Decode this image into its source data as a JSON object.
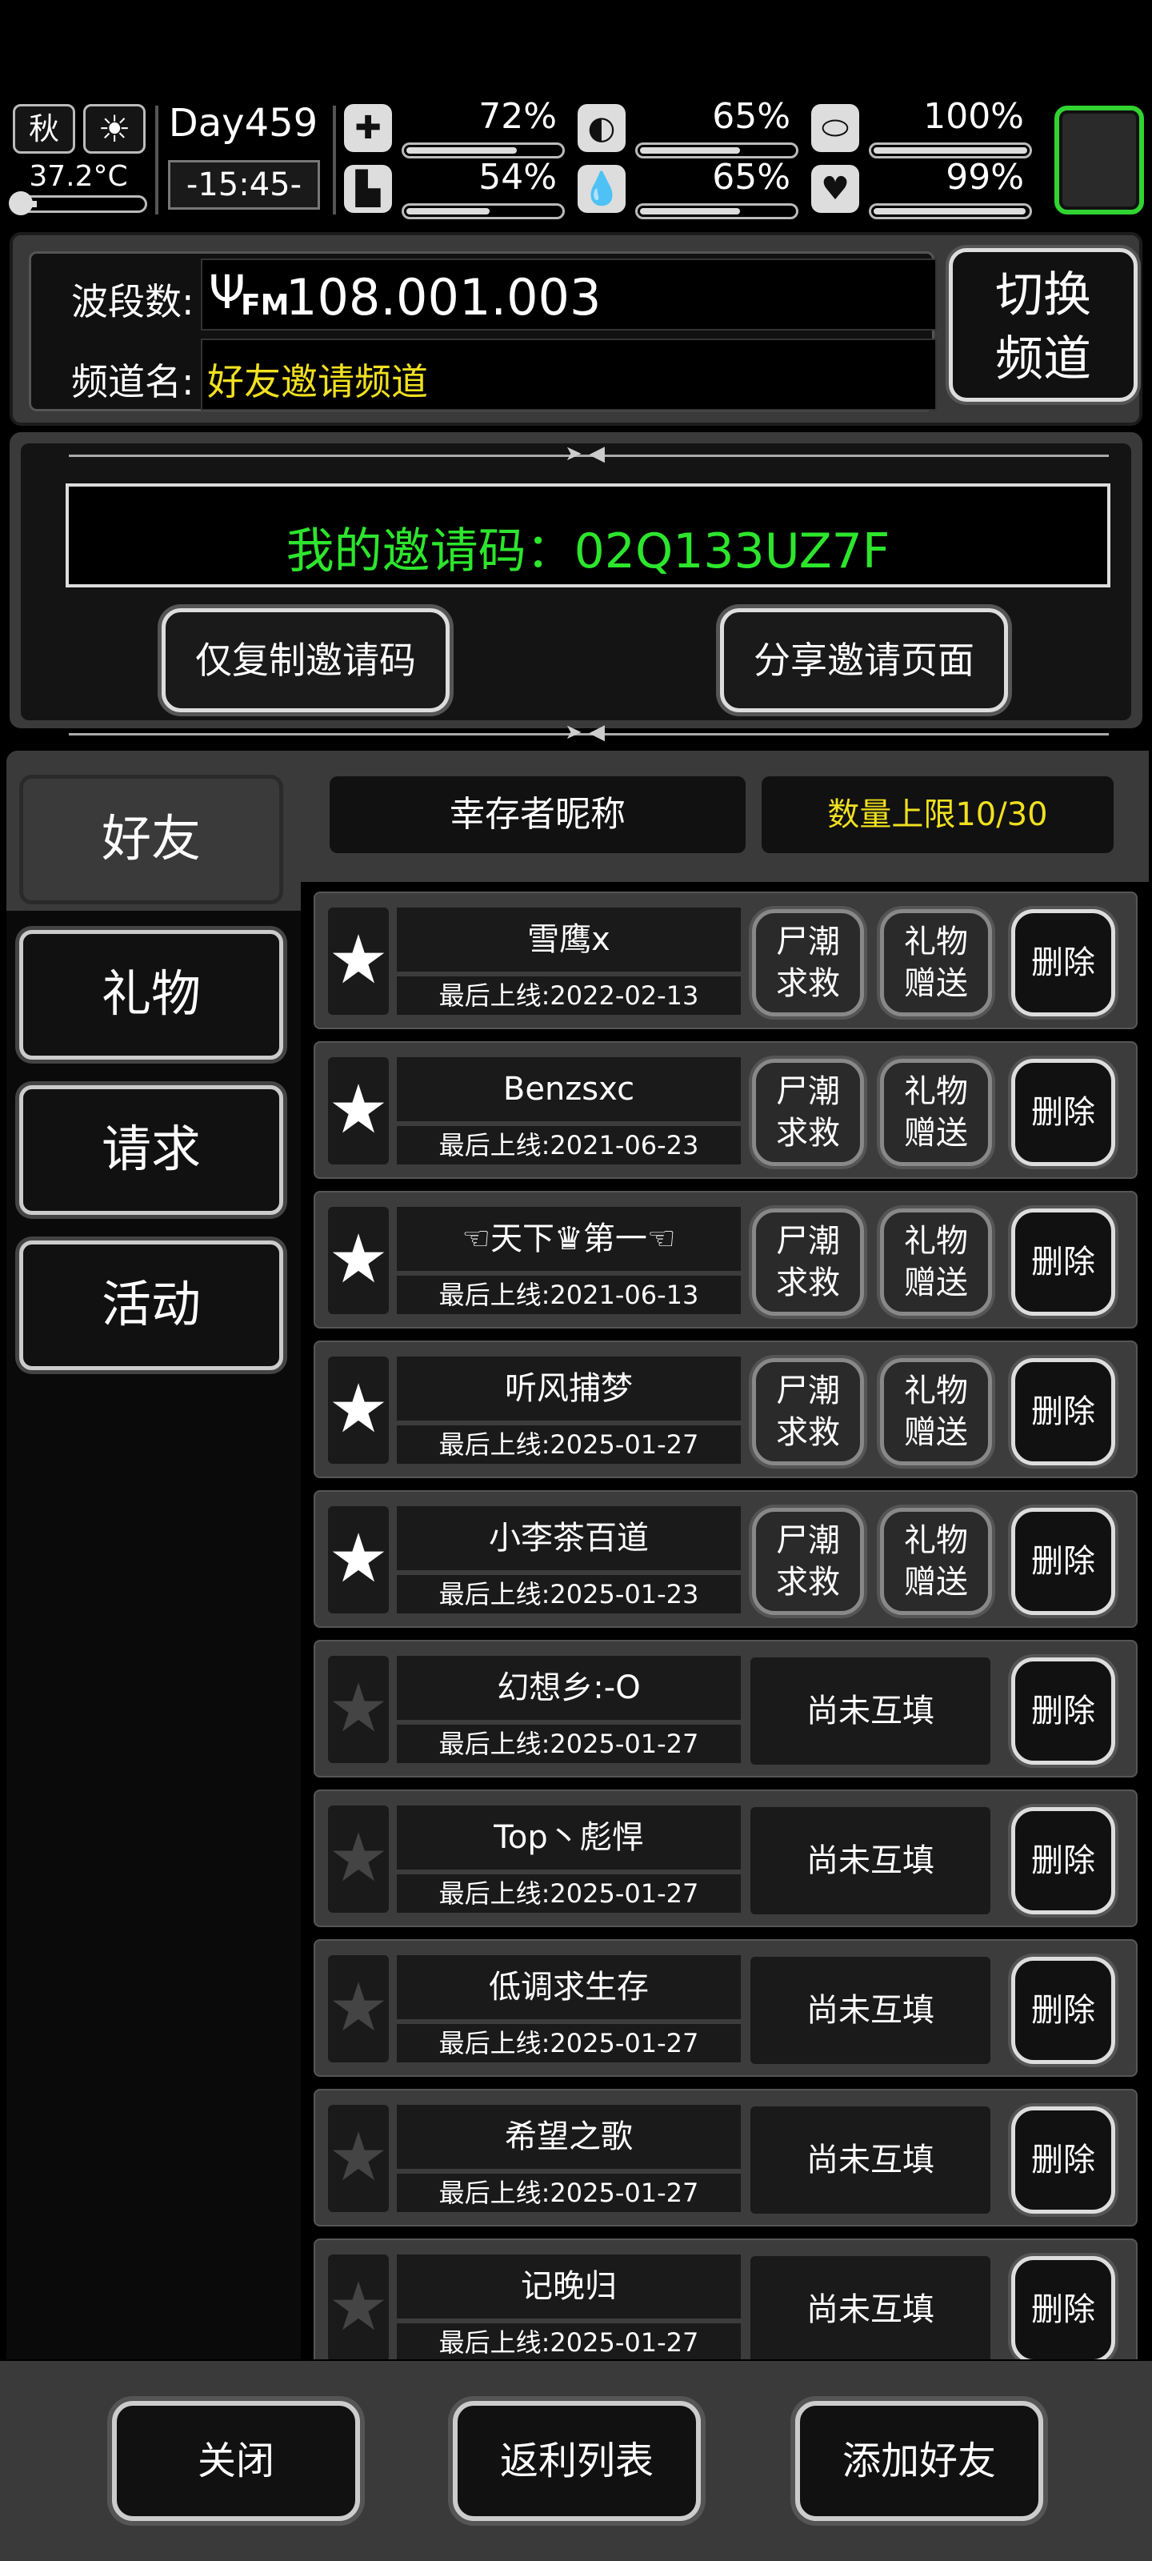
{
  "status": {
    "season": "秋",
    "weather_icon": "sun-icon",
    "temperature": "37.2°C",
    "temperature_level": 0.08,
    "day": "Day459",
    "clock": "-15:45-",
    "stats": [
      {
        "icon": "medkit-icon",
        "glyph": "✚",
        "value": "72%",
        "level": 0.72
      },
      {
        "icon": "stomach-icon",
        "glyph": "◐",
        "value": "65%",
        "level": 0.65
      },
      {
        "icon": "pill-icon",
        "glyph": "⬭",
        "value": "100%",
        "level": 1.0
      },
      {
        "icon": "boot-icon",
        "glyph": "▙",
        "value": "54%",
        "level": 0.54
      },
      {
        "icon": "water-drop-icon",
        "glyph": "💧",
        "value": "65%",
        "level": 0.65
      },
      {
        "icon": "heart-icon",
        "glyph": "♥",
        "value": "99%",
        "level": 0.99
      }
    ]
  },
  "radio": {
    "band_label": "波段数:",
    "fm_icon": "antenna-icon",
    "fm_text": "FM",
    "frequency": "108.001.003",
    "channel_label": "频道名:",
    "channel_name": "好友邀请频道",
    "switch_line1": "切换",
    "switch_line2": "频道"
  },
  "invite": {
    "code_text": "我的邀请码：02Q133UZ7F",
    "copy_button": "仅复制邀请码",
    "share_button": "分享邀请页面"
  },
  "tabs": [
    {
      "label": "好友",
      "active": true
    },
    {
      "label": "礼物",
      "active": false
    },
    {
      "label": "请求",
      "active": false
    },
    {
      "label": "活动",
      "active": false
    }
  ],
  "list_header": {
    "nickname": "幸存者昵称",
    "limit": "数量上限10/30",
    "limit_color": "#f0e020"
  },
  "friends": [
    {
      "name": "雪鹰x",
      "last": "最后上线:2022-02-13",
      "mutual": true
    },
    {
      "name": "Benzsxc",
      "last": "最后上线:2021-06-23",
      "mutual": true
    },
    {
      "name": "☜天下♛第一☜",
      "last": "最后上线:2021-06-13",
      "mutual": true
    },
    {
      "name": "听风捕梦",
      "last": "最后上线:2025-01-27",
      "mutual": true
    },
    {
      "name": "小李茶百道",
      "last": "最后上线:2025-01-23",
      "mutual": true
    },
    {
      "name": "幻想乡:-O",
      "last": "最后上线:2025-01-27",
      "mutual": false
    },
    {
      "name": "Top丶彪悍",
      "last": "最后上线:2025-01-27",
      "mutual": false
    },
    {
      "name": "低调求生存",
      "last": "最后上线:2025-01-27",
      "mutual": false
    },
    {
      "name": "希望之歌",
      "last": "最后上线:2025-01-27",
      "mutual": false
    },
    {
      "name": "记晚归",
      "last": "最后上线:2025-01-27",
      "mutual": false
    }
  ],
  "row_labels": {
    "rescue_1": "尸潮",
    "rescue_2": "求救",
    "gift_1": "礼物",
    "gift_2": "赠送",
    "pending": "尚未互填",
    "delete": "删除"
  },
  "bottom": {
    "close": "关闭",
    "rebate": "返利列表",
    "add_friend": "添加好友"
  },
  "colors": {
    "invite_code": "#2de52d",
    "channel_name": "#f0e020",
    "status_frame": "#31d331"
  }
}
